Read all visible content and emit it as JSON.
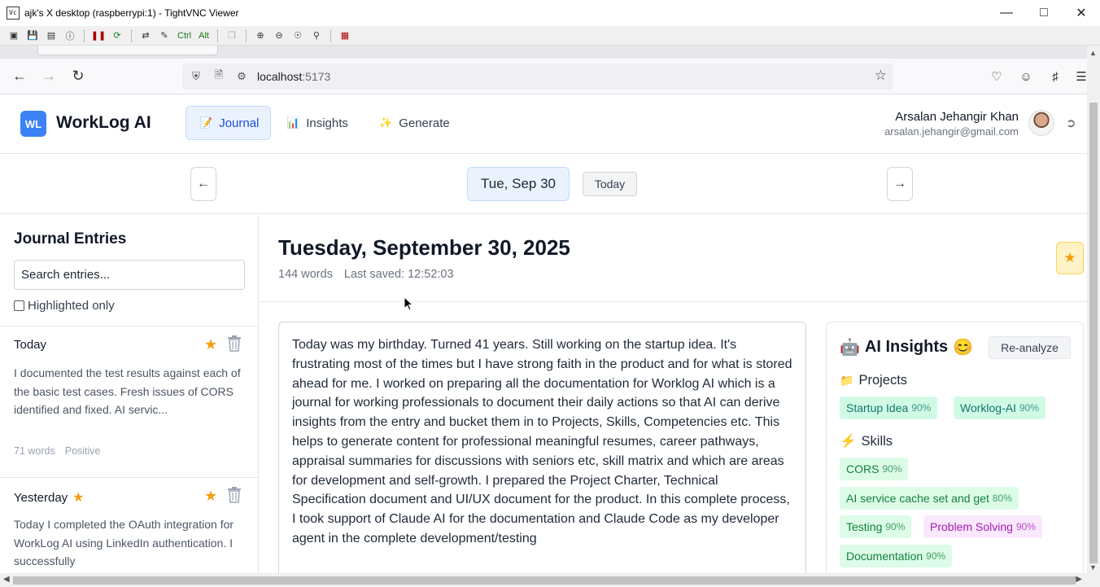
{
  "window": {
    "title": "ajk's X desktop (raspberrypi:1) - TightVNC Viewer",
    "toolbar_ctrl": "Ctrl",
    "toolbar_alt": "Alt"
  },
  "browser": {
    "url_host": "localhost",
    "url_port": ":5173"
  },
  "app": {
    "logo_badge": "WL",
    "logo_text": "WorkLog AI",
    "tabs": [
      {
        "emoji": "📝",
        "label": "Journal"
      },
      {
        "emoji": "📊",
        "label": "Insights"
      },
      {
        "emoji": "✨",
        "label": "Generate"
      }
    ],
    "user": {
      "name": "Arsalan Jehangir Khan",
      "email": "arsalan.jehangir@gmail.com"
    },
    "date_nav": {
      "prev": "←",
      "current": "Tue, Sep 30",
      "today_label": "Today",
      "next": "→"
    }
  },
  "sidebar": {
    "title": "Journal Entries",
    "search_placeholder": "Search entries...",
    "highlight_label": "Highlighted only",
    "entries": [
      {
        "title": "Today",
        "preview": "I documented the test results against each of the basic test cases. Fresh issues of CORS identified and fixed. AI servic...",
        "words": "71 words",
        "sentiment": "Positive"
      },
      {
        "title": "Yesterday",
        "preview": "Today I completed the OAuth integration for WorkLog AI using LinkedIn authentication. I successfully"
      }
    ]
  },
  "main": {
    "date_heading": "Tuesday, September 30, 2025",
    "words": "144 words",
    "last_saved": "Last saved: 12:52:03",
    "body": "Today was my birthday. Turned 41 years. Still working on the startup idea. It's frustrating most of the times but I have strong faith in the product and for what is stored ahead for me. I worked on preparing all the documentation for Worklog AI which is a journal for working professionals to document their daily actions so that AI can derive insights from the entry and bucket them in to Projects, Skills, Competencies etc. This helps to generate content for professional meaningful resumes, career pathways, appraisal summaries for discussions with seniors etc, skill matrix and which are areas for development and self-growth. I prepared the Project Charter, Technical Specification document and UI/UX document for the product. In this complete process, I took support of Claude AI for the documentation and Claude Code as my developer agent in the complete development/testing"
  },
  "ai_panel": {
    "emoji_left": "🤖",
    "title": "AI Insights",
    "emoji_right": "😊",
    "reanalyze": "Re-analyze",
    "projects_icon": "📁",
    "projects_label": "Projects",
    "projects": [
      {
        "name": "Startup Idea",
        "pct": "90%"
      },
      {
        "name": "Worklog-AI",
        "pct": "90%"
      }
    ],
    "skills_icon": "⚡",
    "skills_label": "Skills",
    "skills": [
      {
        "name": "CORS",
        "pct": "90%"
      },
      {
        "name": "AI service cache set and get",
        "pct": "80%"
      },
      {
        "name": "Testing",
        "pct": "90%"
      },
      {
        "name": "Problem Solving",
        "pct": "90%"
      },
      {
        "name": "Documentation",
        "pct": "90%"
      }
    ]
  },
  "colors": {
    "accent": "#3b82f6",
    "star": "#f59e0b",
    "active_tab_bg": "#eaf2fe"
  }
}
